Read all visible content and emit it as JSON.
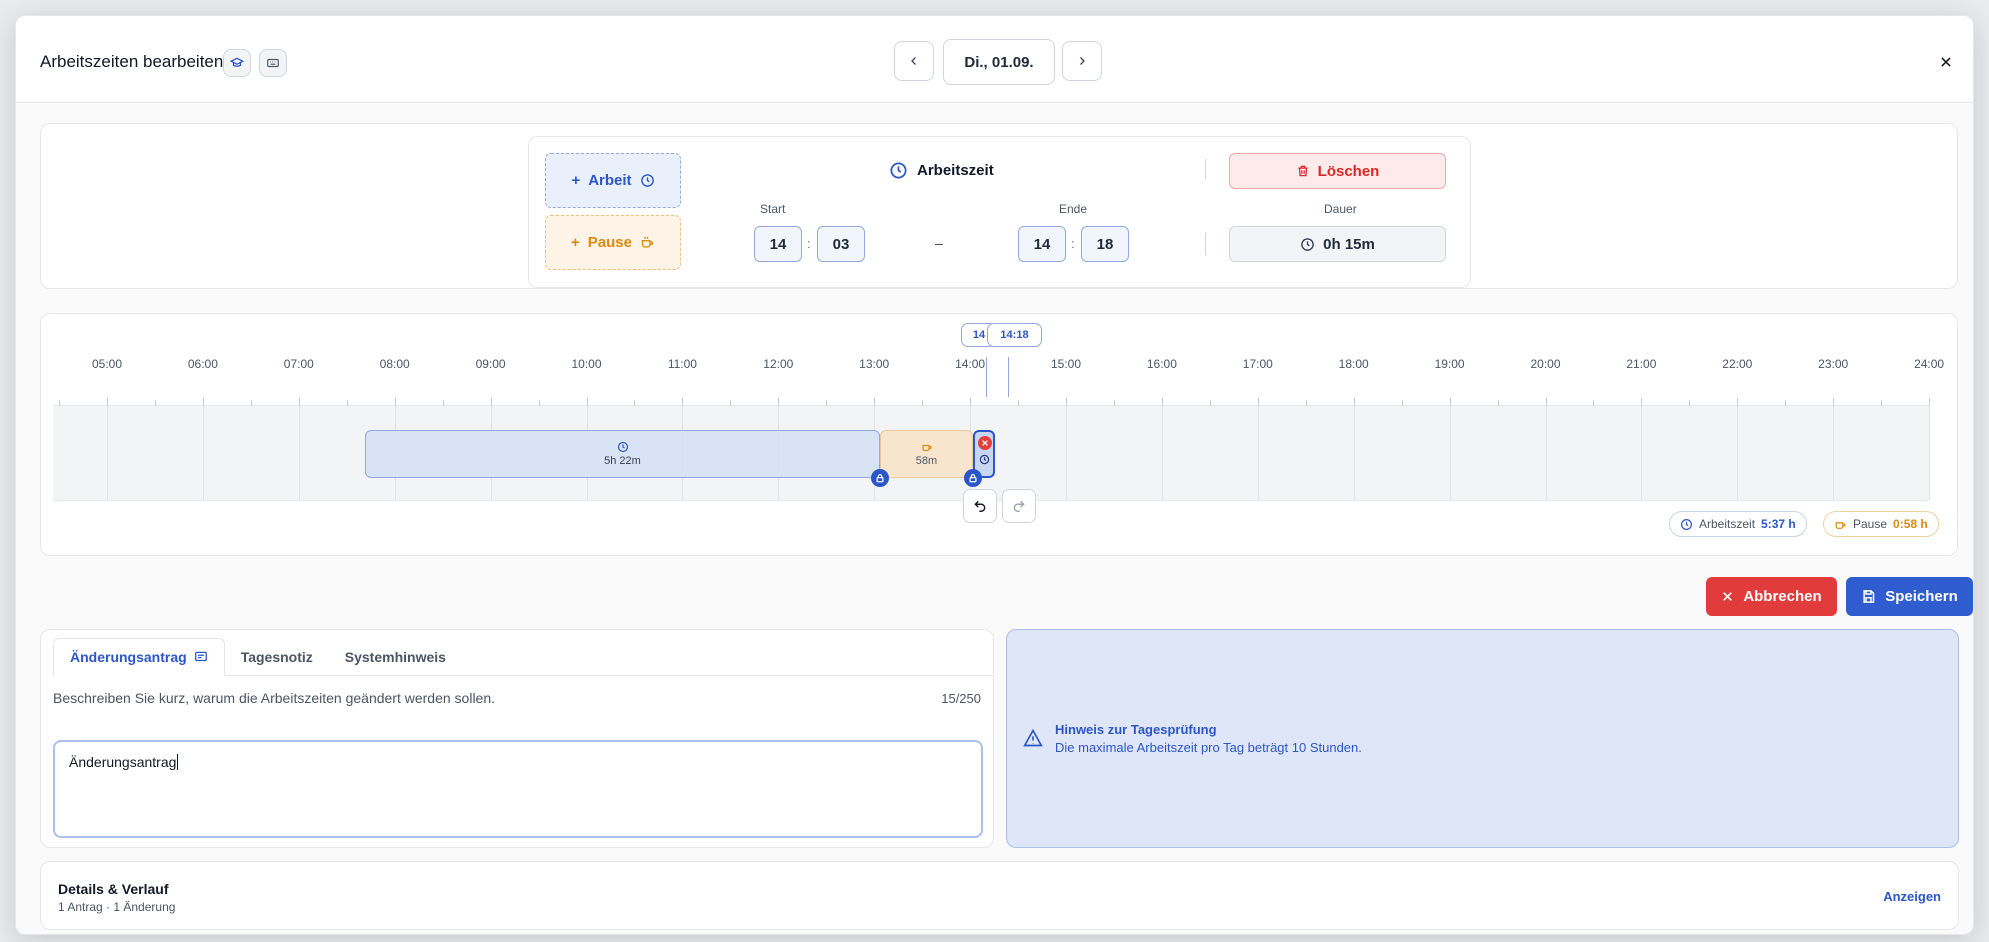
{
  "header": {
    "title": "Arbeitszeiten bearbeiten",
    "date": "Di., 01.09."
  },
  "editor": {
    "add_work_label": "Arbeit",
    "add_pause_label": "Pause",
    "segment_title": "Arbeitszeit",
    "start_label": "Start",
    "end_label": "Ende",
    "start_hour": "14",
    "start_minute": "03",
    "end_hour": "14",
    "end_minute": "18",
    "separator": ":",
    "range_dash": "–",
    "delete_label": "Löschen",
    "duration_label": "Dauer",
    "duration_value": "0h 15m"
  },
  "timeline": {
    "hours": [
      "05:00",
      "06:00",
      "07:00",
      "08:00",
      "09:00",
      "10:00",
      "11:00",
      "12:00",
      "13:00",
      "14:00",
      "15:00",
      "16:00",
      "17:00",
      "18:00",
      "19:00",
      "20:00",
      "21:00",
      "22:00",
      "23:00",
      "24:00"
    ],
    "blocks": [
      {
        "kind": "work",
        "label": "5h 22m"
      },
      {
        "kind": "pause",
        "label": "58m"
      }
    ],
    "start_marker": "14",
    "end_marker": "14:18",
    "summary_work_label": "Arbeitszeit",
    "summary_work_value": "5:37 h",
    "summary_pause_label": "Pause",
    "summary_pause_value": "0:58 h"
  },
  "actions": {
    "cancel_label": "Abbrechen",
    "save_label": "Speichern"
  },
  "tabs": {
    "items": [
      {
        "label": "Änderungsantrag"
      },
      {
        "label": "Tagesnotiz"
      },
      {
        "label": "Systemhinweis"
      }
    ],
    "description": "Beschreiben Sie kurz, warum die Arbeitszeiten geändert werden sollen.",
    "counter": "15/250",
    "textarea_value": "Änderungsantrag"
  },
  "hint": {
    "title": "Hinweis zur Tagesprüfung",
    "text": "Die maximale Arbeitszeit pro Tag beträgt 10 Stunden."
  },
  "details": {
    "title": "Details & Verlauf",
    "subtitle": "1 Antrag · 1 Änderung",
    "link": "Anzeigen"
  },
  "colors": {
    "primary": "#2f5dd0",
    "danger": "#e23b3b",
    "pause": "#dc8a12"
  }
}
